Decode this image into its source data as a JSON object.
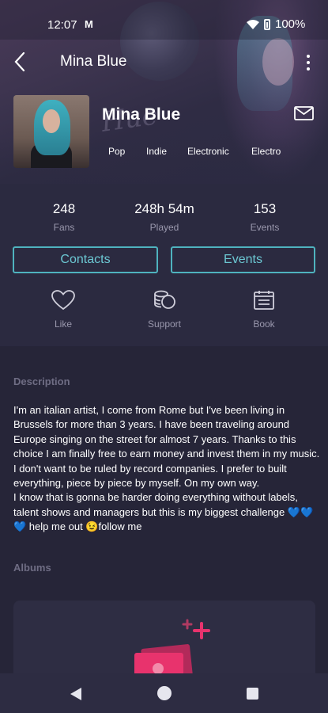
{
  "status_bar": {
    "time": "12:07",
    "carrier_icon": "M",
    "battery": "100%"
  },
  "app_bar": {
    "title": "Mina Blue"
  },
  "profile": {
    "name": "Mina Blue",
    "genres": [
      "Pop",
      "Indie",
      "Electronic",
      "Electro"
    ]
  },
  "stats": [
    {
      "value": "248",
      "label": "Fans"
    },
    {
      "value": "248h 54m",
      "label": "Played"
    },
    {
      "value": "153",
      "label": "Events"
    }
  ],
  "buttons": {
    "contacts": "Contacts",
    "events": "Events"
  },
  "actions": [
    {
      "label": "Like",
      "icon": "heart-icon"
    },
    {
      "label": "Support",
      "icon": "coins-icon"
    },
    {
      "label": "Book",
      "icon": "calendar-icon"
    }
  ],
  "description": {
    "title": "Description",
    "text": "I'm an italian artist, I come from Rome but I've been living in Brussels for more  than 3 years. I have been traveling around Europe singing on the street for almost 7 years. Thanks to this choice I am finally free to earn money and invest them in my music. I don't want to be ruled by record companies. I prefer to built everything, piece by piece by myself. On my own way.\nI know that is gonna be harder doing everything without labels, talent shows and managers but this is my biggest challenge 💙💙💙 help me out 😉follow me"
  },
  "albums": {
    "title": "Albums"
  },
  "colors": {
    "accent": "#4fb3bf",
    "background": "#2b2a40",
    "album_pink": "#e8336d"
  }
}
